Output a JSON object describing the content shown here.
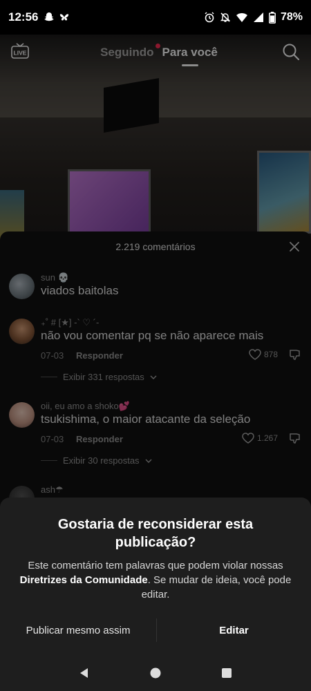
{
  "status_bar": {
    "time": "12:56",
    "battery": "78%"
  },
  "top_nav": {
    "live_label": "LIVE",
    "tab_following": "Seguindo",
    "tab_for_you": "Para você"
  },
  "comments": {
    "count_label": "2.219 comentários",
    "items": [
      {
        "user": "sun 💀",
        "text": "viados baitolas"
      },
      {
        "user": "₊˚ # [★] -` ♡ ´-",
        "text": "não vou comentar pq se não aparece mais",
        "date": "07-03",
        "reply": "Responder",
        "likes": "878",
        "replies": "Exibir 331 respostas"
      },
      {
        "user": "oii, eu amo a shoko💕",
        "text": "tsukishima, o maior atacante da seleção",
        "date": "07-03",
        "reply": "Responder",
        "likes": "1.267",
        "replies": "Exibir 30 respostas"
      },
      {
        "user": "ash☂"
      }
    ]
  },
  "dialog": {
    "title": "Gostaria de reconsiderar esta publicação?",
    "body_prefix": "Este comentário tem palavras que podem violar nossas ",
    "body_bold": "Diretrizes da Comunidade",
    "body_suffix": ". Se mudar de ideia, você pode editar.",
    "publish_button": "Publicar mesmo assim",
    "edit_button": "Editar"
  },
  "colors": {
    "accent": "#fe2c55"
  }
}
